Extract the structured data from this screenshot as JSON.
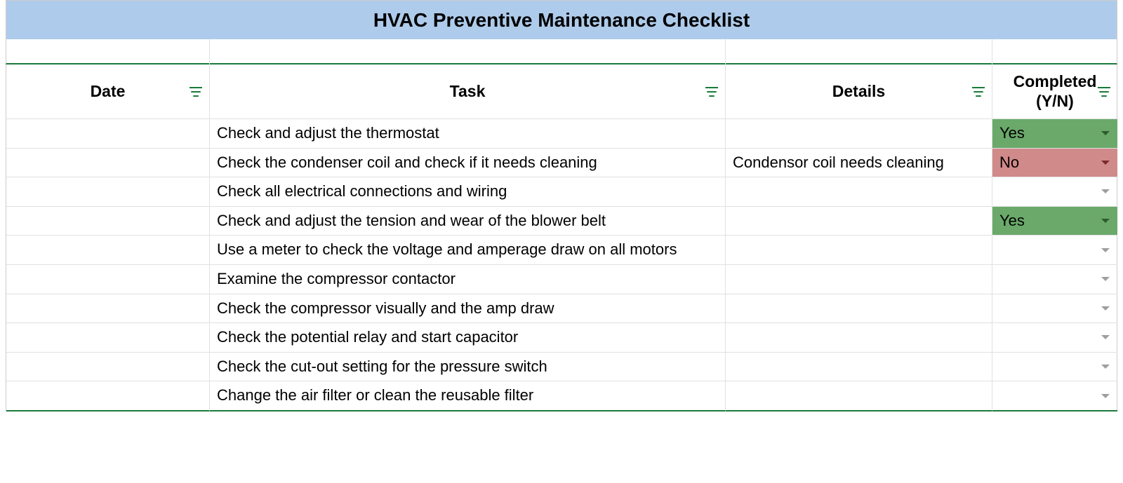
{
  "title": "HVAC Preventive Maintenance Checklist",
  "headers": {
    "date": "Date",
    "task": "Task",
    "details": "Details",
    "completed": "Completed (Y/N)"
  },
  "rows": [
    {
      "date": "",
      "task": "Check and adjust the thermostat",
      "details": "",
      "completed": "Yes",
      "status": "yes"
    },
    {
      "date": "",
      "task": "Check the condenser coil and check if it needs cleaning",
      "details": "Condensor coil needs cleaning",
      "completed": "No",
      "status": "no"
    },
    {
      "date": "",
      "task": "Check all electrical connections and wiring",
      "details": "",
      "completed": "",
      "status": "blank"
    },
    {
      "date": "",
      "task": "Check and adjust the tension and wear of the blower belt",
      "details": "",
      "completed": "Yes",
      "status": "yes"
    },
    {
      "date": "",
      "task": "Use a meter to check the voltage and amperage draw on all motors",
      "details": "",
      "completed": "",
      "status": "blank"
    },
    {
      "date": "",
      "task": "Examine the compressor contactor",
      "details": "",
      "completed": "",
      "status": "blank"
    },
    {
      "date": "",
      "task": "Check the compressor visually and the amp draw",
      "details": "",
      "completed": "",
      "status": "blank"
    },
    {
      "date": "",
      "task": "Check the potential relay and start capacitor",
      "details": "",
      "completed": "",
      "status": "blank"
    },
    {
      "date": "",
      "task": "Check the cut-out setting for the pressure switch",
      "details": "",
      "completed": "",
      "status": "blank"
    },
    {
      "date": "",
      "task": "Change the air filter or clean the reusable filter",
      "details": "",
      "completed": "",
      "status": "blank"
    }
  ]
}
